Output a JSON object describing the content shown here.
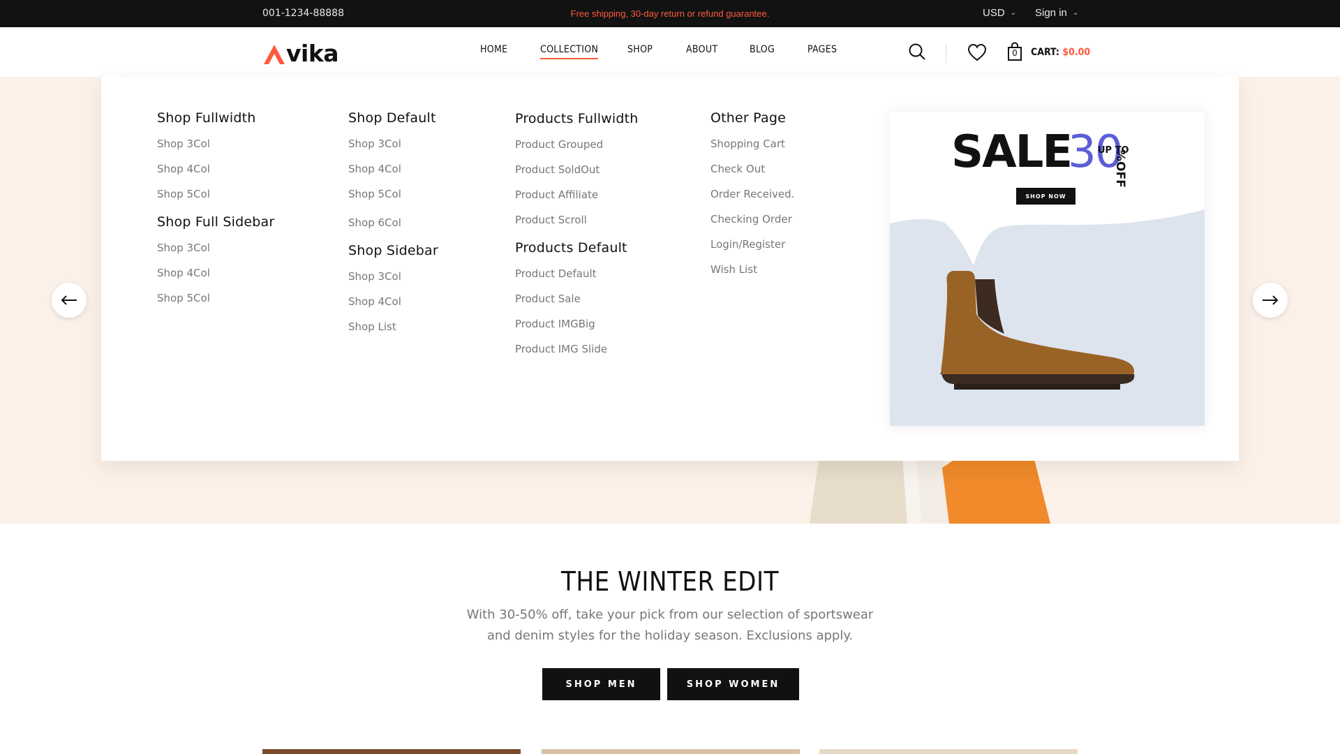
{
  "topbar": {
    "phone": "001-1234-88888",
    "promo": "Free shipping, 30-day return or refund guarantee.",
    "currency": "USD",
    "signin": "Sign in"
  },
  "header": {
    "logo_text": "vika",
    "nav": [
      "HOME",
      "COLLECTION",
      "SHOP",
      "ABOUT",
      "BLOG",
      "PAGES"
    ],
    "active_nav": "COLLECTION",
    "cart_label": "CART:",
    "cart_amount": "$0.00",
    "cart_count": "0"
  },
  "mega_menu": {
    "columns": [
      {
        "groups": [
          {
            "title": "Shop Fullwidth",
            "items": [
              "Shop 3Col",
              "Shop 4Col",
              "Shop 5Col"
            ]
          },
          {
            "title": "Shop Full Sidebar",
            "items": [
              "Shop 3Col",
              "Shop 4Col",
              "Shop 5Col"
            ]
          }
        ]
      },
      {
        "groups": [
          {
            "title": "Shop Default",
            "items": [
              "Shop 3Col",
              "Shop 4Col",
              "Shop 5Col",
              "Shop 6Col"
            ]
          },
          {
            "title": "Shop Sidebar",
            "items": [
              "Shop 3Col",
              "Shop 4Col",
              "Shop List"
            ]
          }
        ]
      },
      {
        "groups": [
          {
            "title": "Products Fullwidth",
            "items": [
              "Product Grouped",
              "Product SoldOut",
              "Product Affiliate",
              "Product Scroll"
            ]
          },
          {
            "title": "Products Default",
            "items": [
              "Product Default",
              "Product Sale",
              "Product IMGBig",
              "Product IMG Slide"
            ]
          }
        ]
      },
      {
        "groups": [
          {
            "title": "Other Page",
            "items": [
              "Shopping Cart",
              "Check Out",
              "Order Received.",
              "Checking Order",
              "Login/Register",
              "Wish List"
            ]
          }
        ]
      }
    ],
    "promo": {
      "sale": "SALE",
      "number": "30",
      "upto": "UP TO",
      "off": "%OFF",
      "button": "SHOP NOW"
    }
  },
  "winter": {
    "title": "THE WINTER EDIT",
    "description": "With 30-50% off, take your pick from our selection of sportswear and denim styles for the holiday season. Exclusions apply.",
    "btn_men": "SHOP MEN",
    "btn_women": "SHOP WOMEN"
  },
  "colors": {
    "accent": "#ff5a3c",
    "topbar_bg": "#121212",
    "hero_bg": "#fcf1e9",
    "promo_number": "#5b5ed6"
  },
  "icons": [
    "search-icon",
    "heart-icon",
    "cart-bag-icon",
    "arrow-left-icon",
    "arrow-right-icon",
    "chevron-down-icon"
  ]
}
